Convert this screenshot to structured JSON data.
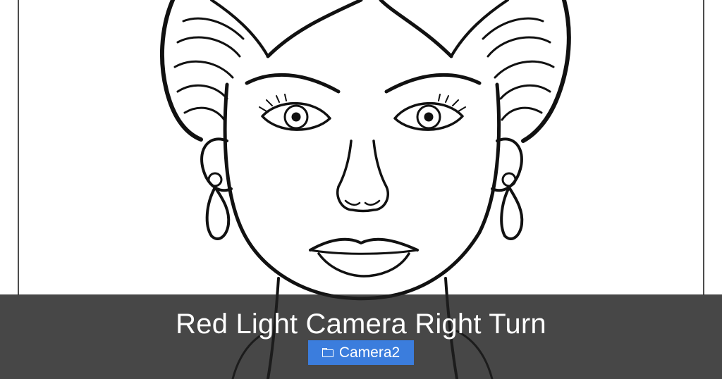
{
  "caption": {
    "title": "Red Light Camera Right Turn"
  },
  "badge": {
    "label": "Camera2",
    "icon": "folder-icon",
    "color": "#3b7ddd"
  },
  "colors": {
    "overlay": "#1e1e1e",
    "line_art": "#111111"
  }
}
